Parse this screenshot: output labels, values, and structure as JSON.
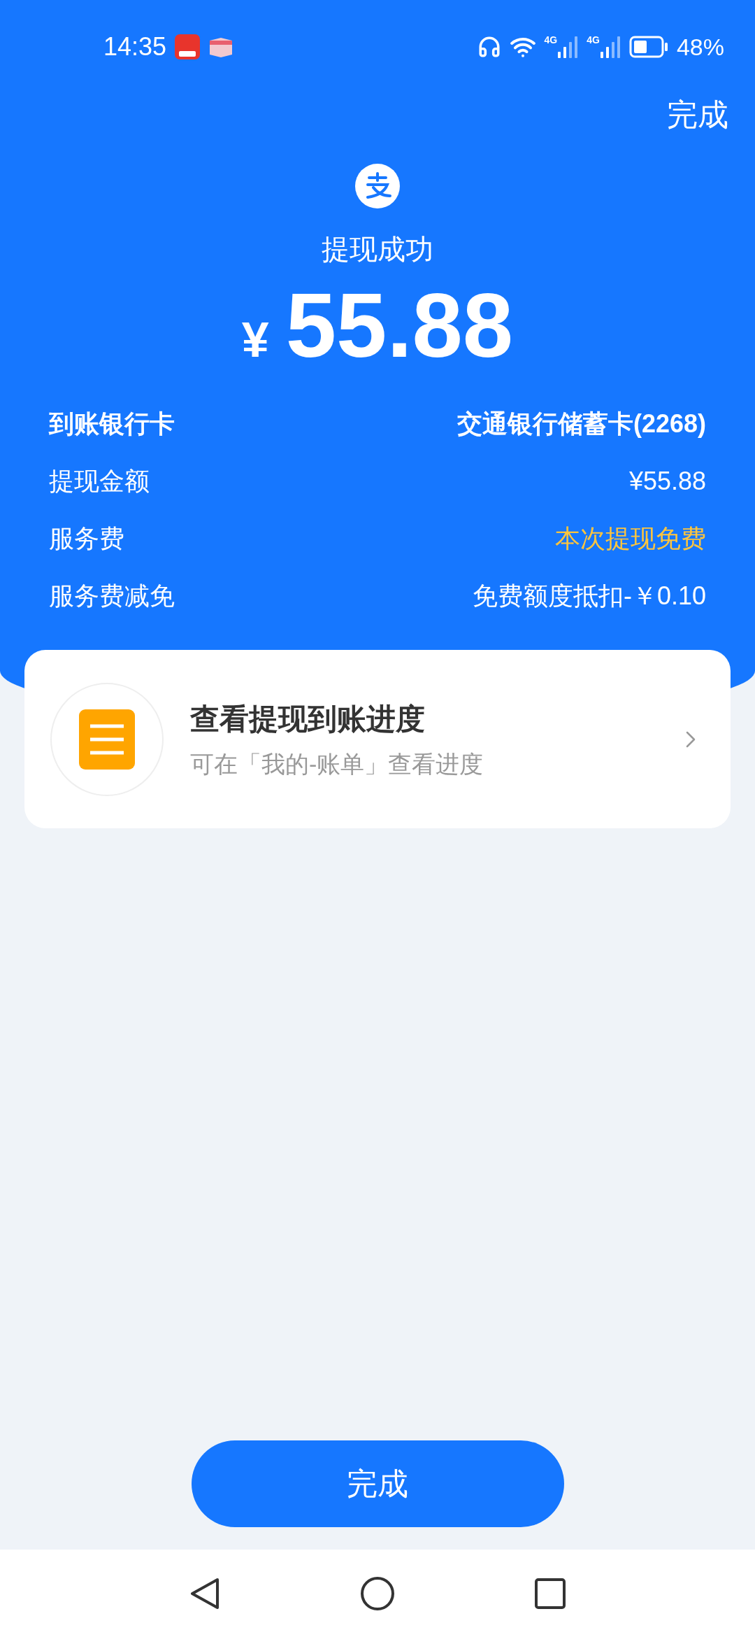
{
  "status_bar": {
    "time": "14:35",
    "networks": [
      "4G",
      "4G"
    ],
    "battery": "48%"
  },
  "header": {
    "done": "完成",
    "title": "提现成功",
    "currency": "¥",
    "amount": "55.88"
  },
  "details": [
    {
      "label": "到账银行卡",
      "value": "交通银行储蓄卡(2268)",
      "kind": "bold"
    },
    {
      "label": "提现金额",
      "value": "¥55.88",
      "kind": "normal"
    },
    {
      "label": "服务费",
      "value": "本次提现免费",
      "kind": "highlight"
    },
    {
      "label": "服务费减免",
      "value": "免费额度抵扣-￥0.10",
      "kind": "normal"
    }
  ],
  "progress_card": {
    "title": "查看提现到账进度",
    "subtitle": "可在「我的-账单」查看进度"
  },
  "button": {
    "label": "完成"
  }
}
